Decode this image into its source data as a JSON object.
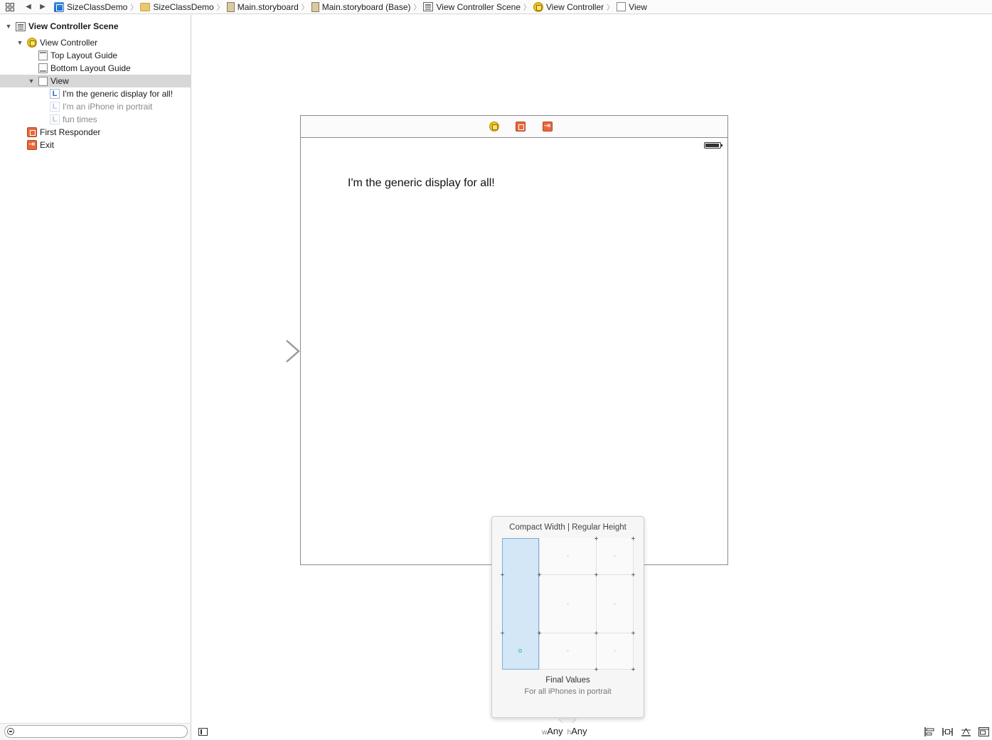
{
  "jumpbar": {
    "crumbs": [
      {
        "icon": "project-icon",
        "label": "SizeClassDemo"
      },
      {
        "icon": "folder-icon",
        "label": "SizeClassDemo"
      },
      {
        "icon": "storyboard-icon",
        "label": "Main.storyboard"
      },
      {
        "icon": "storyboard-icon",
        "label": "Main.storyboard (Base)"
      },
      {
        "icon": "scene-icon",
        "label": "View Controller Scene"
      },
      {
        "icon": "view-controller-icon",
        "label": "View Controller"
      },
      {
        "icon": "view-icon",
        "label": "View"
      }
    ]
  },
  "outline": {
    "rows": [
      {
        "label": "View Controller Scene",
        "icon": "scene-icon"
      },
      {
        "label": "View Controller",
        "icon": "view-controller-icon"
      },
      {
        "label": "Top Layout Guide",
        "icon": "top-layout-guide-icon"
      },
      {
        "label": "Bottom Layout Guide",
        "icon": "bottom-layout-guide-icon"
      },
      {
        "label": "View",
        "icon": "view-icon",
        "selected": true
      },
      {
        "label": "I'm the generic display for all!",
        "icon": "label-icon"
      },
      {
        "label": "I'm an iPhone in portrait",
        "icon": "label-icon",
        "dimmed": true
      },
      {
        "label": "fun times",
        "icon": "label-icon",
        "dimmed": true
      },
      {
        "label": "First Responder",
        "icon": "first-responder-icon"
      },
      {
        "label": "Exit",
        "icon": "exit-icon"
      }
    ],
    "filter_placeholder": ""
  },
  "canvas": {
    "label_text": "I'm the generic display for all!"
  },
  "popover": {
    "title": "Compact Width | Regular Height",
    "final_title": "Final Values",
    "final_desc": "For all iPhones in portrait"
  },
  "bottombar": {
    "width_prefix": "w",
    "width_value": "Any",
    "height_prefix": "h",
    "height_value": "Any"
  },
  "colors": {
    "selection": "#d7d7d7",
    "grid_highlight": "#d3e7f7",
    "active_dot": "#2bc18b"
  }
}
